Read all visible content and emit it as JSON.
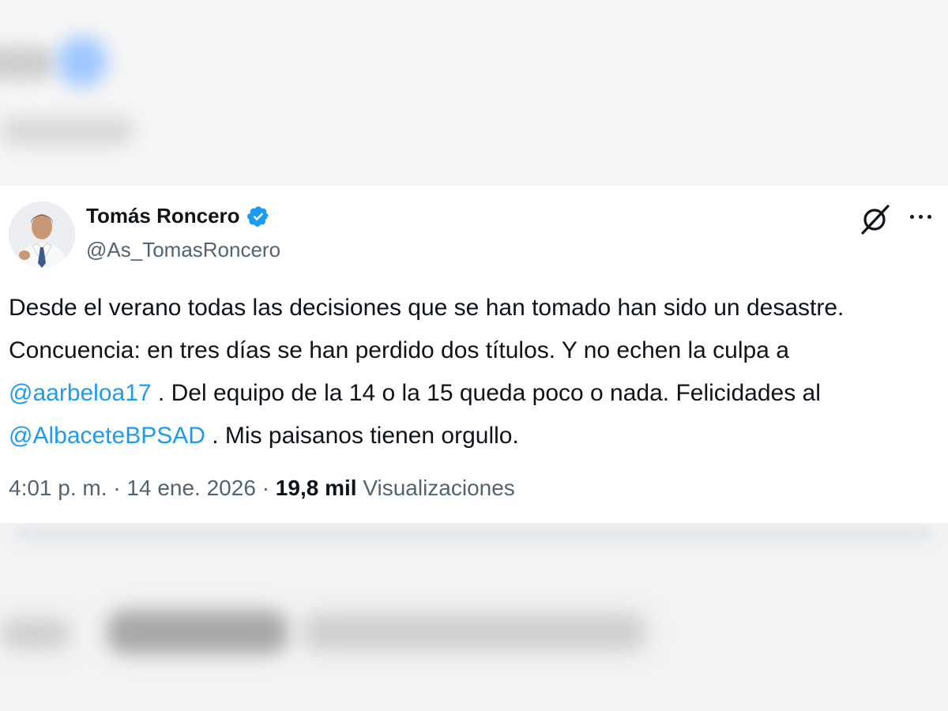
{
  "tweet": {
    "author": {
      "name": "Tomás Roncero",
      "handle": "@As_TomasRoncero",
      "verified": true
    },
    "text": {
      "part1": "Desde el verano todas las decisiones que se han tomado han sido un desastre. Concuencia: en tres días se han perdido dos títulos. Y no echen la culpa a ",
      "mention1": "@aarbeloa17",
      "part2": " . Del equipo de la 14 o la 15 queda poco o nada. Felicidades al ",
      "mention2": "@AlbaceteBPSAD",
      "part3": " . Mis paisanos tienen orgullo."
    },
    "meta": {
      "time": "4:01 p. m.",
      "separator": "·",
      "date": "14 ene. 2026",
      "views_count": "19,8 mil",
      "views_label": "Visualizaciones"
    }
  },
  "icons": {
    "verified": "verified-badge-icon",
    "grok": "grok-icon",
    "more": "more-options-icon"
  },
  "colors": {
    "text": "#0f1419",
    "secondary": "#536471",
    "link": "#1d9bf0",
    "verified": "#1d9bf0",
    "background": "#ffffff"
  }
}
